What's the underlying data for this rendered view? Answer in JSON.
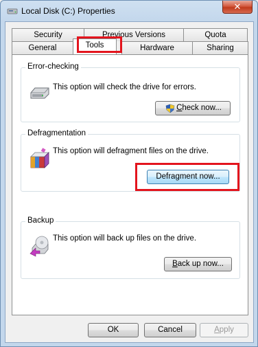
{
  "window": {
    "title": "Local Disk (C:) Properties",
    "close_label": "✕"
  },
  "tabs": {
    "row1": [
      "Security",
      "Previous Versions",
      "Quota"
    ],
    "row2": [
      "General",
      "Tools",
      "Hardware",
      "Sharing"
    ],
    "active": "Tools"
  },
  "sections": {
    "error_checking": {
      "title": "Error-checking",
      "description": "This option will check the drive for errors.",
      "button_mnemonic": "C",
      "button_rest": "heck now..."
    },
    "defragmentation": {
      "title": "Defragmentation",
      "description": "This option will defragment files on the drive.",
      "button_label": "Defragment now..."
    },
    "backup": {
      "title": "Backup",
      "description": "This option will back up files on the drive.",
      "button_mnemonic": "B",
      "button_rest": "ack up now..."
    }
  },
  "footer": {
    "ok_label": "OK",
    "cancel_label": "Cancel",
    "apply_mnemonic": "A",
    "apply_rest": "pply"
  },
  "colors": {
    "highlight": "#e3141d",
    "close_button": "#c13a1c"
  }
}
